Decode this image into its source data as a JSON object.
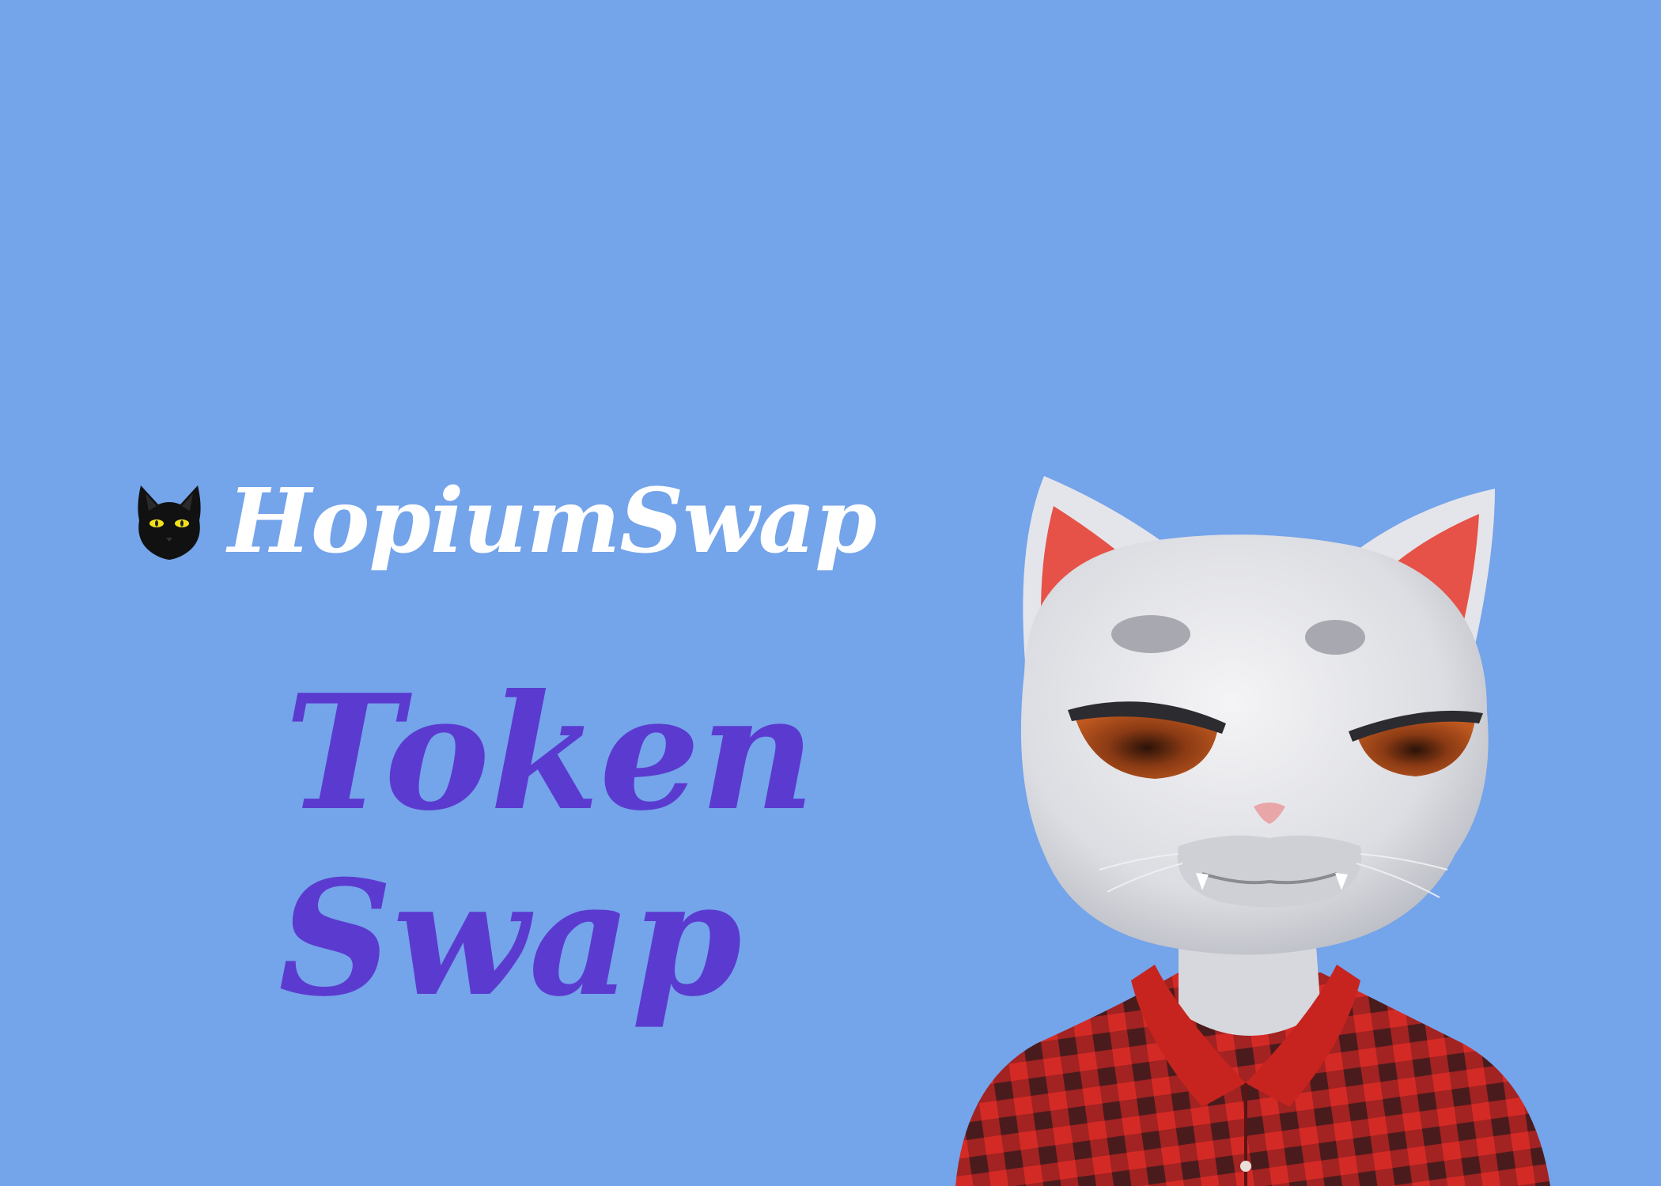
{
  "brand": {
    "name": "HopiumSwap",
    "logo_icon": "black-cat-icon"
  },
  "headline": {
    "line1": "Token",
    "line2": "Swap"
  },
  "mascot": {
    "icon": "white-cat-mascot-icon"
  },
  "colors": {
    "background": "#74a4ea",
    "headline": "#5b3bcf",
    "brand_text": "#ffffff",
    "shirt_red": "#d42a25",
    "shirt_dark": "#3a1a1c"
  }
}
